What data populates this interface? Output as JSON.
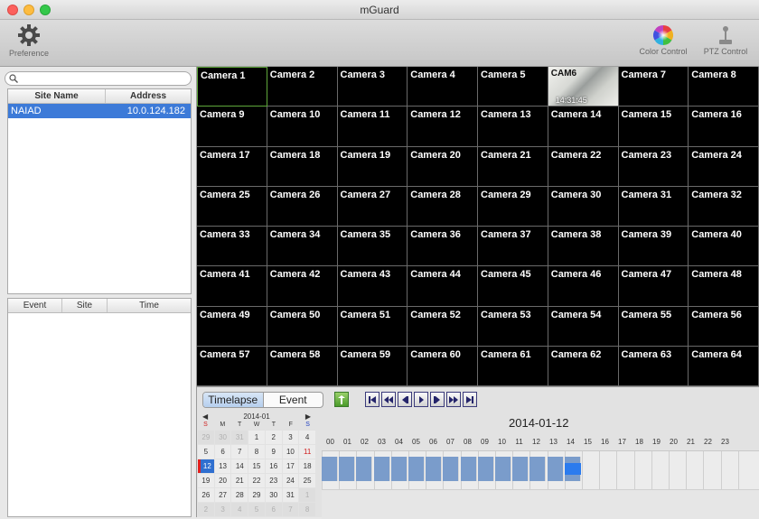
{
  "window": {
    "title": "mGuard"
  },
  "toolbar": {
    "preference_label": "Preference",
    "color_control_label": "Color Control",
    "ptz_control_label": "PTZ Control"
  },
  "sites": {
    "search_placeholder": "",
    "columns": [
      "Site Name",
      "Address"
    ],
    "rows": [
      {
        "name": "NAIAD",
        "address": "10.0.124.182"
      }
    ]
  },
  "events": {
    "columns": [
      "Event",
      "Site",
      "Time"
    ]
  },
  "cameras": [
    "Camera 1",
    "Camera 2",
    "Camera 3",
    "Camera 4",
    "Camera 5",
    "CAM6",
    "Camera 7",
    "Camera 8",
    "Camera 9",
    "Camera 10",
    "Camera 11",
    "Camera 12",
    "Camera 13",
    "Camera 14",
    "Camera 15",
    "Camera 16",
    "Camera 17",
    "Camera 18",
    "Camera 19",
    "Camera 20",
    "Camera 21",
    "Camera 22",
    "Camera 23",
    "Camera 24",
    "Camera 25",
    "Camera 26",
    "Camera 27",
    "Camera 28",
    "Camera 29",
    "Camera 30",
    "Camera 31",
    "Camera 32",
    "Camera 33",
    "Camera 34",
    "Camera 35",
    "Camera 36",
    "Camera 37",
    "Camera 38",
    "Camera 39",
    "Camera 40",
    "Camera 41",
    "Camera 42",
    "Camera 43",
    "Camera 44",
    "Camera 45",
    "Camera 46",
    "Camera 47",
    "Camera 48",
    "Camera 49",
    "Camera 50",
    "Camera 51",
    "Camera 52",
    "Camera 53",
    "Camera 54",
    "Camera 55",
    "Camera 56",
    "Camera 57",
    "Camera 58",
    "Camera 59",
    "Camera 60",
    "Camera 61",
    "Camera 62",
    "Camera 63",
    "Camera 64"
  ],
  "live_camera": {
    "name": "CAM6",
    "timestamp": "14:31:45"
  },
  "playback": {
    "tabs": [
      "Timelapse",
      "Event"
    ],
    "active_tab": "Timelapse",
    "controls": [
      "refresh",
      "first",
      "fast-rewind",
      "step-back",
      "play",
      "step-forward",
      "fast-forward",
      "last"
    ]
  },
  "calendar": {
    "month_label": "2014-01",
    "prev": "◀",
    "next": "▶",
    "dows": [
      "S",
      "M",
      "T",
      "W",
      "T",
      "F",
      "S"
    ],
    "days": [
      {
        "d": "29",
        "out": true
      },
      {
        "d": "30",
        "out": true
      },
      {
        "d": "31",
        "out": true
      },
      {
        "d": "1"
      },
      {
        "d": "2"
      },
      {
        "d": "3"
      },
      {
        "d": "4"
      },
      {
        "d": "5"
      },
      {
        "d": "6"
      },
      {
        "d": "7"
      },
      {
        "d": "8"
      },
      {
        "d": "9"
      },
      {
        "d": "10"
      },
      {
        "d": "11",
        "red": true
      },
      {
        "d": "12",
        "today": true
      },
      {
        "d": "13"
      },
      {
        "d": "14"
      },
      {
        "d": "15"
      },
      {
        "d": "16"
      },
      {
        "d": "17"
      },
      {
        "d": "18"
      },
      {
        "d": "19"
      },
      {
        "d": "20"
      },
      {
        "d": "21"
      },
      {
        "d": "22"
      },
      {
        "d": "23"
      },
      {
        "d": "24"
      },
      {
        "d": "25"
      },
      {
        "d": "26"
      },
      {
        "d": "27"
      },
      {
        "d": "28"
      },
      {
        "d": "29"
      },
      {
        "d": "30"
      },
      {
        "d": "31"
      },
      {
        "d": "1",
        "out": true
      },
      {
        "d": "2",
        "out": true
      },
      {
        "d": "3",
        "out": true
      },
      {
        "d": "4",
        "out": true
      },
      {
        "d": "5",
        "out": true
      },
      {
        "d": "6",
        "out": true
      },
      {
        "d": "7",
        "out": true
      },
      {
        "d": "8",
        "out": true
      }
    ]
  },
  "timeline": {
    "date": "2014-01-12",
    "hours": [
      "00",
      "01",
      "02",
      "03",
      "04",
      "05",
      "06",
      "07",
      "08",
      "09",
      "10",
      "11",
      "12",
      "13",
      "14",
      "15",
      "16",
      "17",
      "18",
      "19",
      "20",
      "21",
      "22",
      "23"
    ],
    "recorded_hours": 15,
    "cursor_hour": 14,
    "colors": {
      "recorded": "#7a9ccb",
      "cursor": "#2b7bee"
    }
  }
}
